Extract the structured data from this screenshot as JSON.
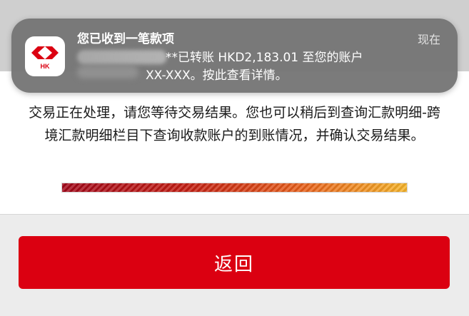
{
  "notification": {
    "app_icon_name": "hsbc-hk-app-icon",
    "app_badge": "HK",
    "title": "您已收到一笔款项",
    "time": "现在",
    "body_line1": "**已转账 HKD2,183.01 至您的账户",
    "body_line2": "XX-XXX。按此查看详情。"
  },
  "page": {
    "message": "交易正在处理，请您等待交易结果。您也可以稍后到查询汇款明细-跨境汇款明细栏目下查询收款账户的到账情况，并确认交易结果。",
    "progress_fraction": 1.0,
    "back_label": "返回"
  },
  "colors": {
    "brand_red": "#db0011",
    "notification_bg": "#767676",
    "progress_start": "#a3081a",
    "progress_end": "#f7b52a"
  }
}
